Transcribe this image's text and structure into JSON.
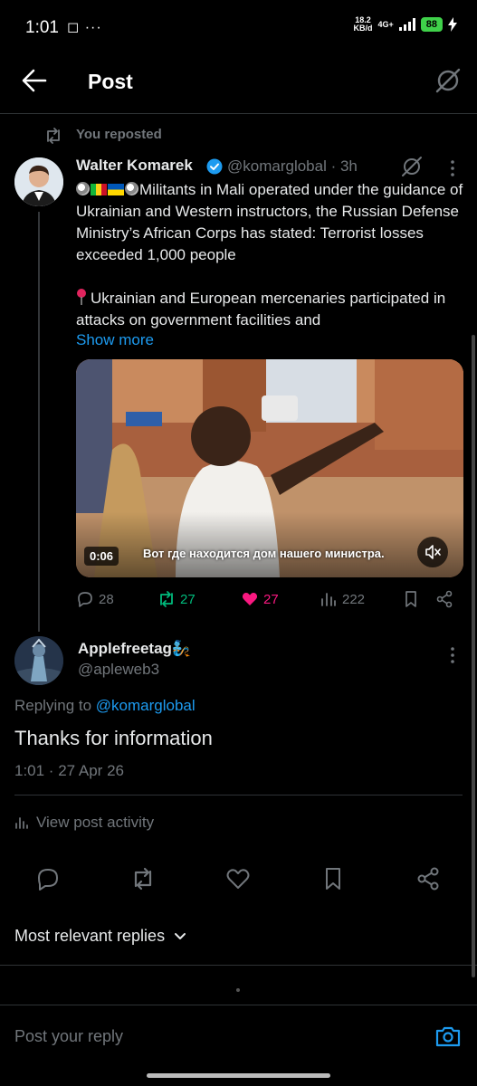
{
  "status": {
    "time": "1:01",
    "left_icons": "◻ ···",
    "net_speed_top": "18.2",
    "net_speed_bottom": "KB/d",
    "net_type": "4G+",
    "battery": "88"
  },
  "header": {
    "title": "Post",
    "back_icon": "arrow-left-icon",
    "grok_icon": "grok-icon"
  },
  "repost": {
    "text": "You reposted"
  },
  "tweet": {
    "author_name": "Walter Komarek",
    "handle_time": "@komarglobal · 3h",
    "paragraph1": "Militants in Mali operated under the guidance of Ukrainian and Western instructors, the Russian Defense Ministry’s African Corps has stated: Terrorist losses exceeded 1,000 people",
    "paragraph2": "Ukrainian and European mercenaries participated in attacks on government facilities and",
    "show_more": "Show more",
    "video_time": "0:06",
    "video_subtitle": "Вот где находится дом нашего министра.",
    "replies": "28",
    "reposts": "27",
    "likes": "27",
    "views": "222"
  },
  "reply": {
    "name": "Applefreetag🧞",
    "handle": "@apleweb3",
    "replying_to_label": "Replying to ",
    "replying_to_handle": "@komarglobal",
    "text": "Thanks for information",
    "time": "1:01 · 27 Apr 26",
    "activity": "View post activity"
  },
  "sort": {
    "label": "Most relevant replies"
  },
  "composer": {
    "placeholder": "Post your reply"
  },
  "colors": {
    "accent": "#1d9bf0",
    "repost_green": "#00ba7c",
    "like_pink": "#f91880",
    "muted": "#71767b"
  }
}
